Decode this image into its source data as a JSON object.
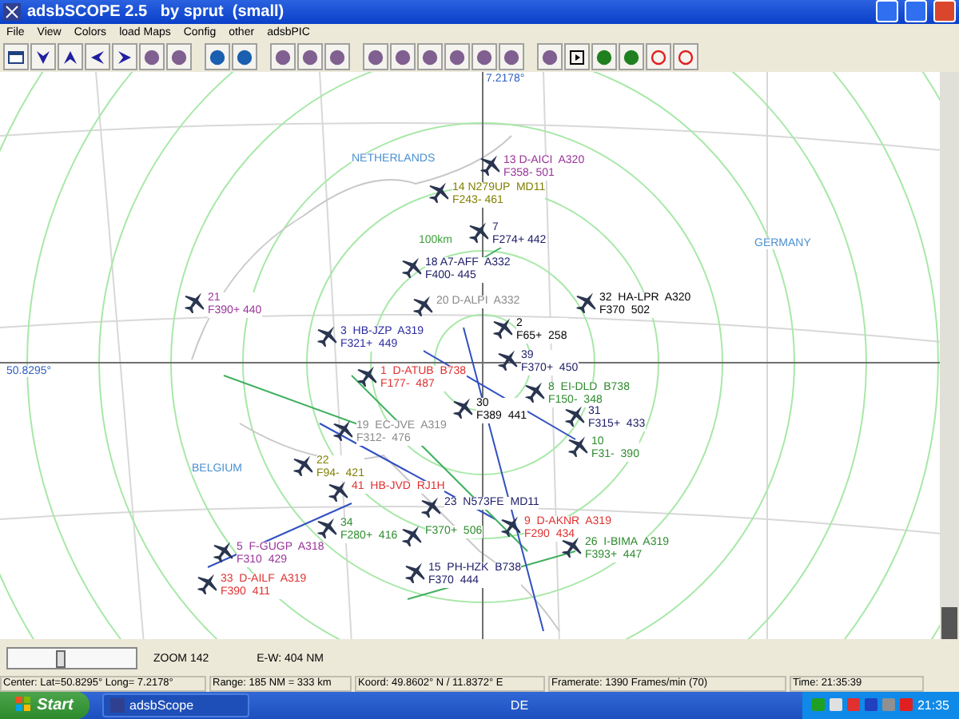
{
  "window": {
    "title": "adsbSCOPE 2.5   by sprut  (small)"
  },
  "menu": [
    "File",
    "View",
    "Colors",
    "load Maps",
    "Config",
    "other",
    "adsbPIC"
  ],
  "map": {
    "longitude": "7.2178°",
    "latitude": "50.8295°",
    "range_label": "100km",
    "regions": [
      {
        "name": "NETHERLANDS"
      },
      {
        "name": "GERMANY"
      },
      {
        "name": "BELGIUM"
      }
    ],
    "aircraft": [
      {
        "lines": [
          "13 D-AICI  A320",
          "F358- 501"
        ],
        "color": "#993399"
      },
      {
        "lines": [
          "14 N279UP  MD11",
          "F243- 461"
        ],
        "color": "#808000"
      },
      {
        "lines": [
          "7",
          "F274+ 442"
        ],
        "color": "#1a1a66"
      },
      {
        "lines": [
          "18 A7-AFF  A332",
          "F400- 445"
        ],
        "color": "#1a1a66"
      },
      {
        "lines": [
          "21",
          "F390+ 440"
        ],
        "color": "#993399"
      },
      {
        "lines": [
          "20 D-ALPI  A332"
        ],
        "color": "#8a8a8a"
      },
      {
        "lines": [
          "32  HA-LPR  A320",
          "F370  502"
        ],
        "color": "#000000"
      },
      {
        "lines": [
          "2",
          "F65+  258"
        ],
        "color": "#000000"
      },
      {
        "lines": [
          "3  HB-JZP  A319",
          "F321+  449"
        ],
        "color": "#2a2aa0"
      },
      {
        "lines": [
          "39",
          "F370+  450"
        ],
        "color": "#1a1a66"
      },
      {
        "lines": [
          "1  D-ATUB  B738",
          "F177-  487"
        ],
        "color": "#e03030"
      },
      {
        "lines": [
          "8  EI-DLD  B738",
          "F150-  348"
        ],
        "color": "#2e8b2e"
      },
      {
        "lines": [
          "30",
          "F389  441"
        ],
        "color": "#000000"
      },
      {
        "lines": [
          "31",
          "F315+  433"
        ],
        "color": "#1a1a66"
      },
      {
        "lines": [
          "19  EC-JVE  A319",
          "F312-  476"
        ],
        "color": "#8a8a8a"
      },
      {
        "lines": [
          "10",
          "F31-  390"
        ],
        "color": "#2e8b2e"
      },
      {
        "lines": [
          "22",
          "F94-  421"
        ],
        "color": "#808000"
      },
      {
        "lines": [
          "41  HB-JVD  RJ1H"
        ],
        "color": "#e03030"
      },
      {
        "lines": [
          "23  N573FE  MD11"
        ],
        "color": "#1a1a66"
      },
      {
        "lines": [
          "34",
          "F280+  416"
        ],
        "color": "#2e8b2e"
      },
      {
        "lines": [
          "F370+  506"
        ],
        "color": "#2e8b2e"
      },
      {
        "lines": [
          "9  D-AKNR  A319",
          "F290  434"
        ],
        "color": "#e03030"
      },
      {
        "lines": [
          "5  F-GUGP  A318",
          "F310  429"
        ],
        "color": "#993399"
      },
      {
        "lines": [
          "26  I-BIMA  A319",
          "F393+  447"
        ],
        "color": "#2e8b2e"
      },
      {
        "lines": [
          "15  PH-HZK  B738",
          "F370  444"
        ],
        "color": "#1a1a66"
      },
      {
        "lines": [
          "33  D-AILF  A319",
          "F390  411"
        ],
        "color": "#e03030"
      }
    ]
  },
  "zoom": {
    "level": 0.4,
    "label": "ZOOM 142",
    "ew": "E-W: 404 NM"
  },
  "status_bar": [
    "Center: Lat=50.8295° Long= 7.2178°",
    "Range: 185 NM = 333 km",
    "Koord: 49.8602° N / 11.8372° E",
    "Framerate:  1390 Frames/min (70)",
    "Time: 21:35:39"
  ],
  "taskbar": {
    "start": "Start",
    "task": "adsbScope",
    "language": "DE",
    "clock": "21:35"
  }
}
